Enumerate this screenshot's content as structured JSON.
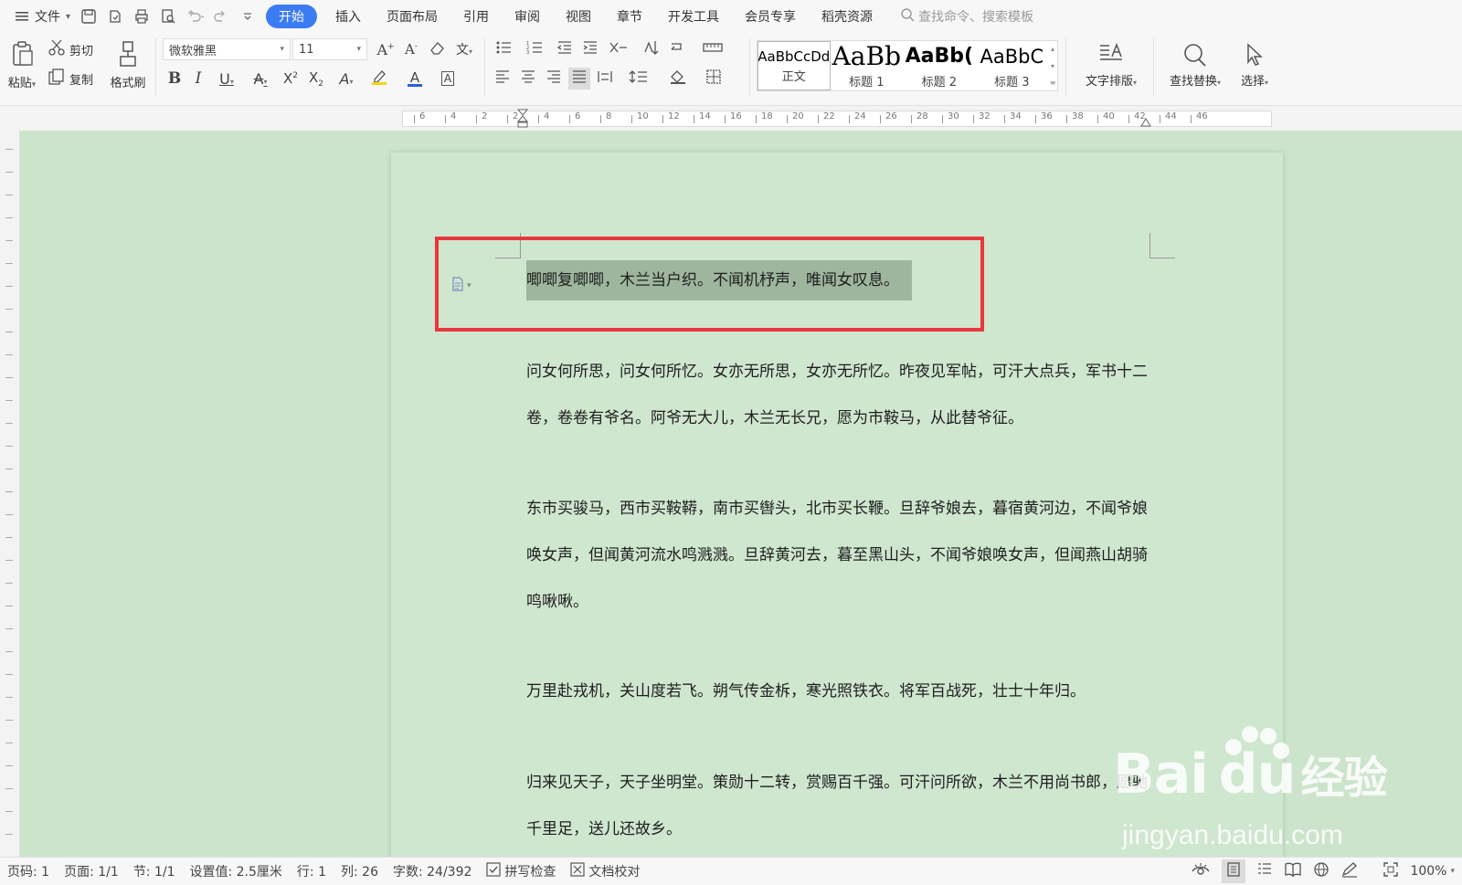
{
  "menubar": {
    "file_label": "文件",
    "tabs": [
      "开始",
      "插入",
      "页面布局",
      "引用",
      "审阅",
      "视图",
      "章节",
      "开发工具",
      "会员专享",
      "稻壳资源"
    ],
    "active_tab": "开始",
    "search_placeholder": "查找命令、搜索模板"
  },
  "ribbon": {
    "paste": "粘贴",
    "cut": "剪切",
    "copy": "复制",
    "format_painter": "格式刷",
    "font_name": "微软雅黑",
    "font_size": "11",
    "styles": [
      {
        "preview": "AaBbCcDd",
        "name": "正文"
      },
      {
        "preview": "AaBb",
        "name": "标题 1"
      },
      {
        "preview": "AaBb(",
        "name": "标题 2"
      },
      {
        "preview": "AaBbC",
        "name": "标题 3"
      }
    ],
    "text_layout": "文字排版",
    "find_replace": "查找替换",
    "select": "选择"
  },
  "ruler": {
    "ticks": [
      "6",
      "4",
      "2",
      "2",
      "4",
      "6",
      "8",
      "10",
      "12",
      "14",
      "16",
      "18",
      "20",
      "22",
      "24",
      "26",
      "28",
      "30",
      "32",
      "34",
      "36",
      "38",
      "40",
      "42",
      "44",
      "46"
    ]
  },
  "document": {
    "paragraphs": [
      "唧唧复唧唧，木兰当户织。不闻机杼声，唯闻女叹息。",
      "问女何所思，问女何所忆。女亦无所思，女亦无所忆。昨夜见军帖，可汗大点兵，军书十二卷，卷卷有爷名。阿爷无大儿，木兰无长兄，愿为市鞍马，从此替爷征。",
      "东市买骏马，西市买鞍鞯，南市买辔头，北市买长鞭。旦辞爷娘去，暮宿黄河边，不闻爷娘唤女声，但闻黄河流水鸣溅溅。旦辞黄河去，暮至黑山头，不闻爷娘唤女声，但闻燕山胡骑鸣啾啾。",
      "万里赴戎机，关山度若飞。朔气传金柝，寒光照铁衣。将军百战死，壮士十年归。",
      "归来见天子，天子坐明堂。策勋十二转，赏赐百千强。可汗问所欲，木兰不用尚书郎，愿驰千里足，送儿还故乡。"
    ]
  },
  "watermark": {
    "brand": "Bai",
    "brand_suffix": "du",
    "brand_cn": "经验",
    "url": "jingyan.baidu.com"
  },
  "status": {
    "page_num": "页码: 1",
    "pages": "页面: 1/1",
    "section": "节: 1/1",
    "setting": "设置值: 2.5厘米",
    "line": "行: 1",
    "column": "列: 26",
    "word_count": "字数: 24/392",
    "spell_check": "拼写检查",
    "doc_proof": "文档校对",
    "zoom": "100%"
  },
  "colors": {
    "accent": "#3b7cf4",
    "highlight_box": "#e8383d",
    "page_bg": "#cfe6cf",
    "selection": "#9fb69e"
  }
}
